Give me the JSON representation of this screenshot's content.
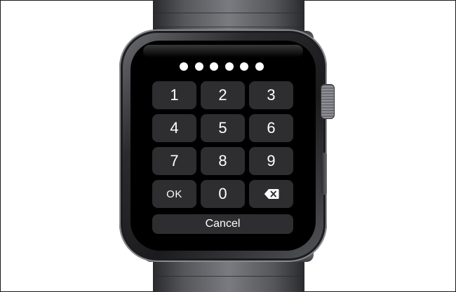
{
  "passcode": {
    "dot_count": 6,
    "digits_entered": 6
  },
  "keypad": {
    "keys": [
      {
        "label": "1",
        "name": "key-1"
      },
      {
        "label": "2",
        "name": "key-2"
      },
      {
        "label": "3",
        "name": "key-3"
      },
      {
        "label": "4",
        "name": "key-4"
      },
      {
        "label": "5",
        "name": "key-5"
      },
      {
        "label": "6",
        "name": "key-6"
      },
      {
        "label": "7",
        "name": "key-7"
      },
      {
        "label": "8",
        "name": "key-8"
      },
      {
        "label": "9",
        "name": "key-9"
      },
      {
        "label": "OK",
        "name": "ok-button"
      },
      {
        "label": "0",
        "name": "key-0"
      },
      {
        "label": "",
        "name": "delete-button",
        "icon": "backspace-icon"
      }
    ],
    "cancel_label": "Cancel"
  },
  "colors": {
    "screen_background": "#000000",
    "key_background": "#2e2e30",
    "text": "#ffffff"
  }
}
